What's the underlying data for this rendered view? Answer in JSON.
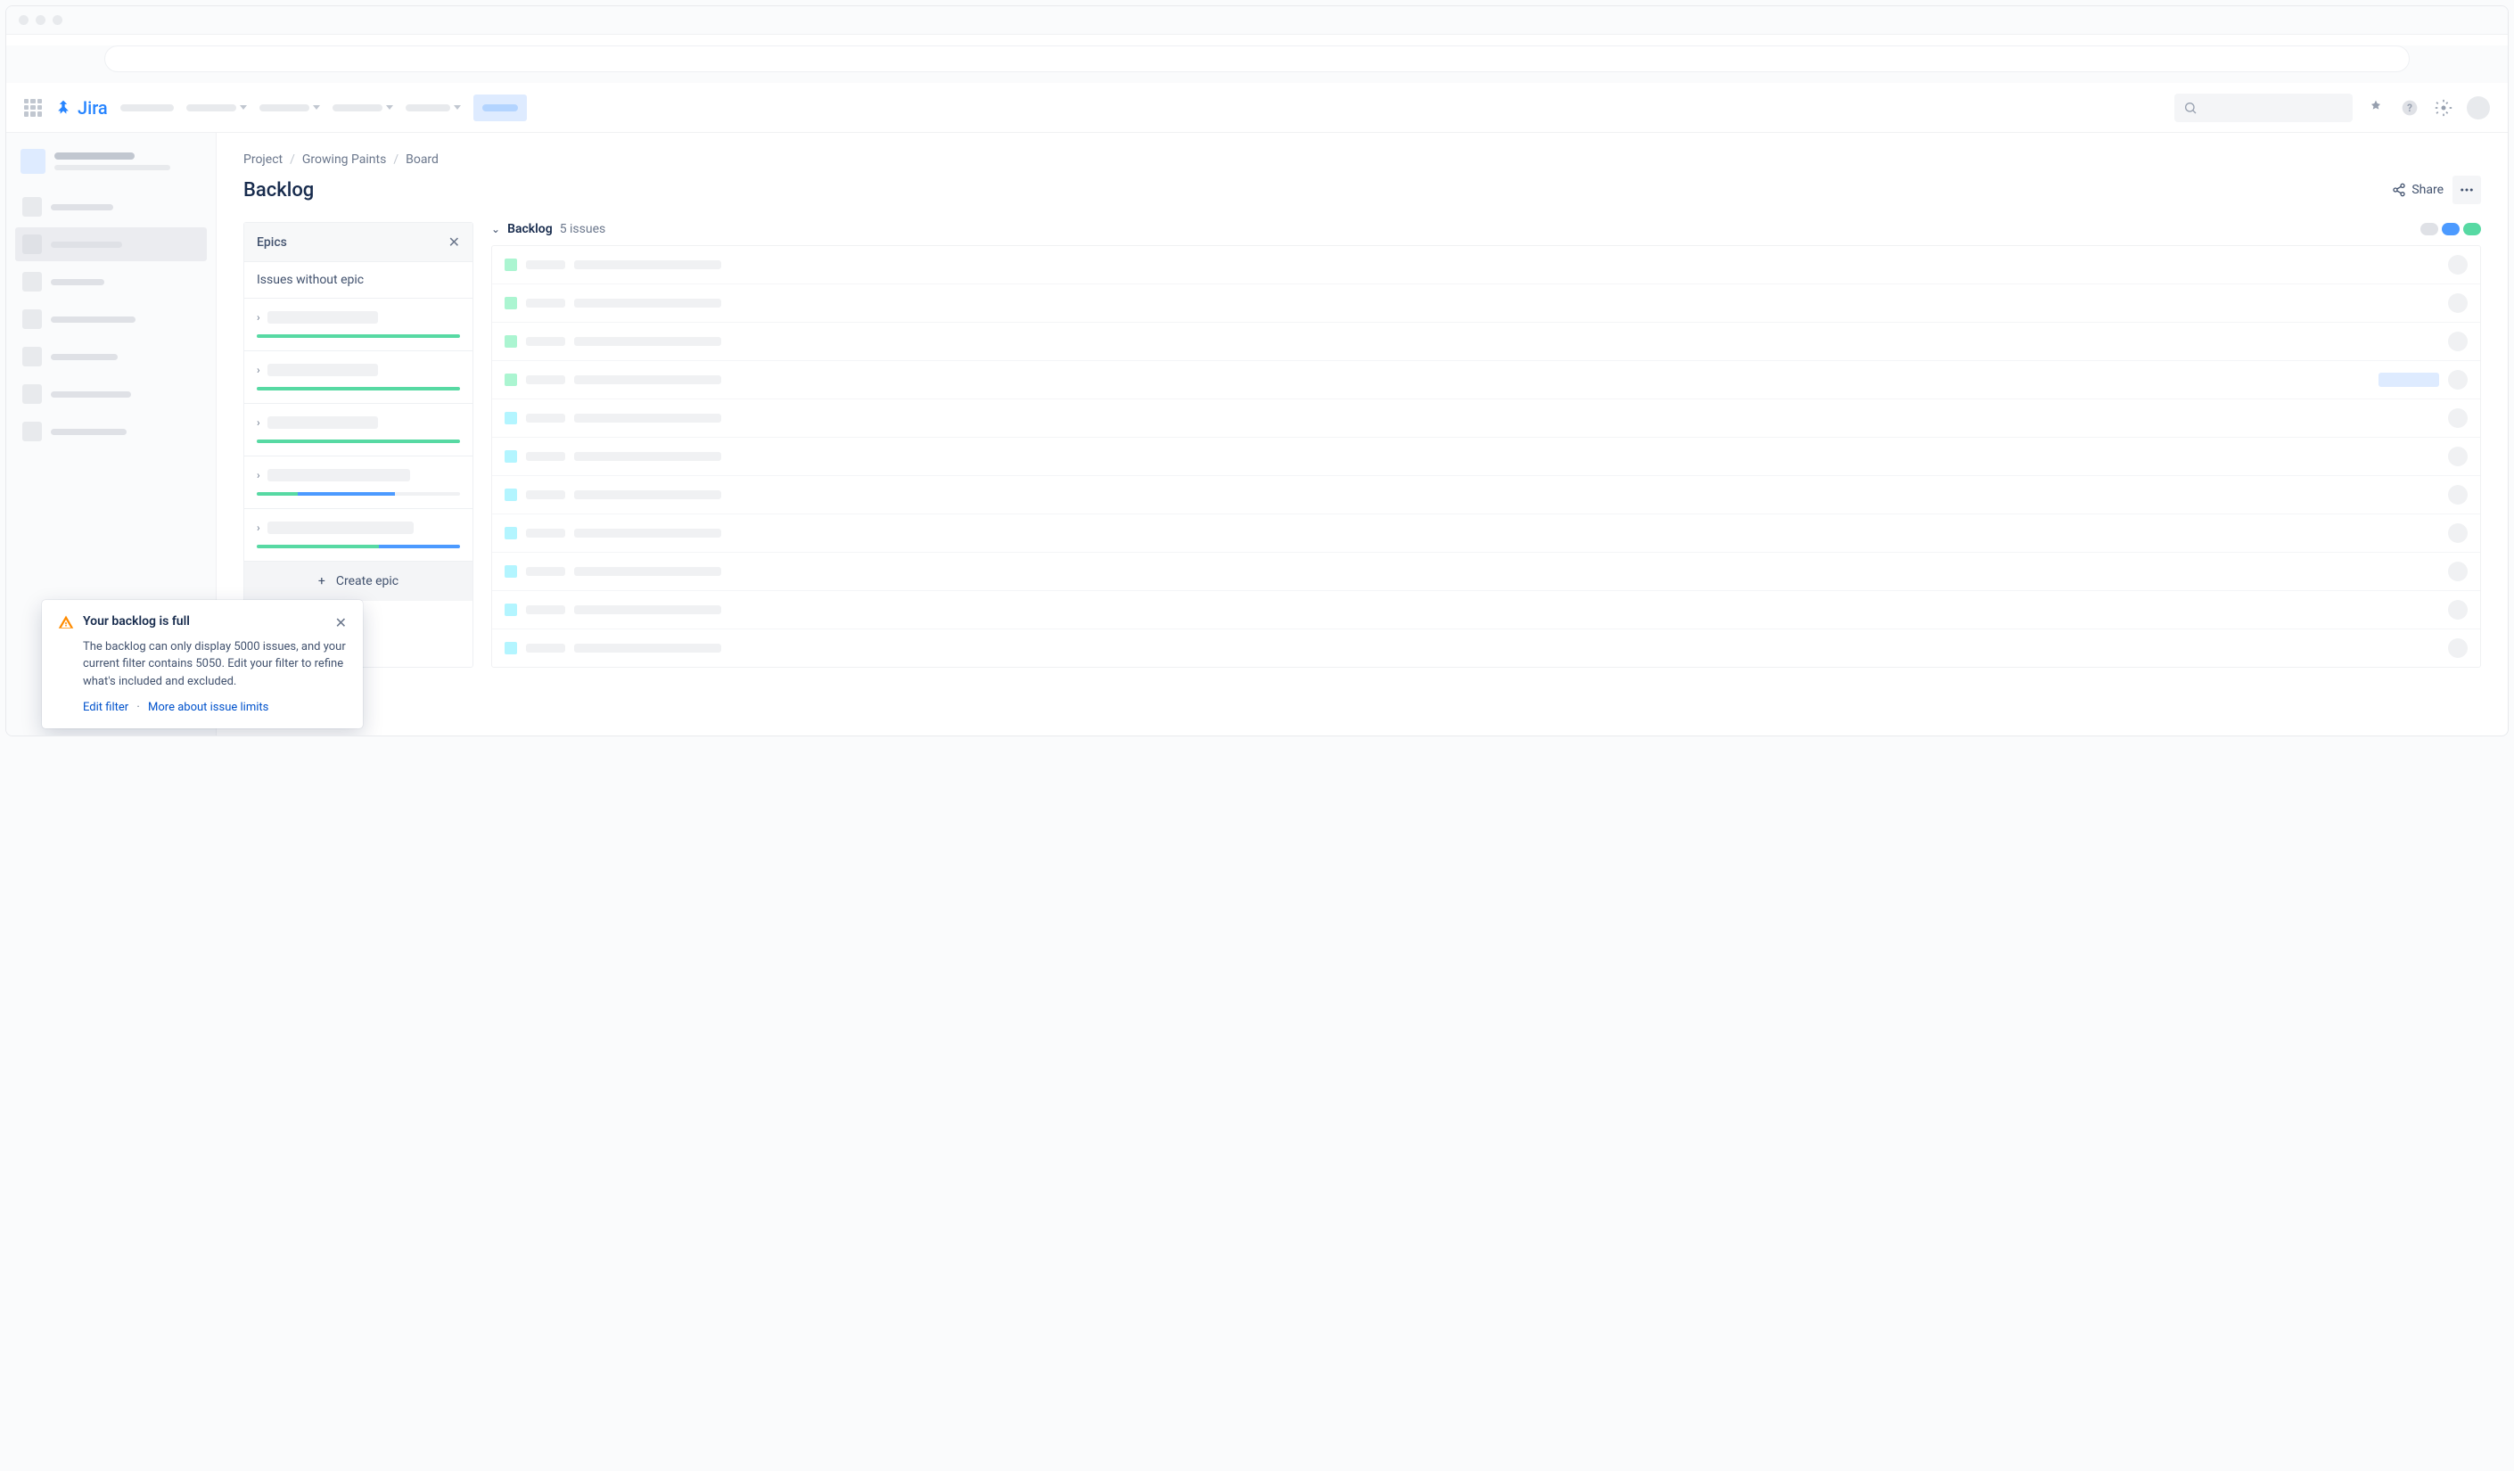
{
  "app": {
    "name": "Jira"
  },
  "breadcrumb": {
    "project": "Project",
    "growing_paints": "Growing Paints",
    "board": "Board"
  },
  "page": {
    "title": "Backlog"
  },
  "actions": {
    "share": "Share"
  },
  "epics": {
    "header": "Epics",
    "no_epic": "Issues without epic",
    "items": [
      {
        "progress": [
          {
            "w": 100,
            "c": "#57d9a3"
          }
        ]
      },
      {
        "progress": [
          {
            "w": 100,
            "c": "#57d9a3"
          }
        ]
      },
      {
        "progress": [
          {
            "w": 100,
            "c": "#57d9a3"
          }
        ]
      },
      {
        "progress": [
          {
            "w": 20,
            "c": "#57d9a3"
          },
          {
            "w": 48,
            "c": "#4c9aff"
          }
        ]
      },
      {
        "progress": [
          {
            "w": 60,
            "c": "#57d9a3"
          },
          {
            "w": 40,
            "c": "#4c9aff"
          }
        ]
      }
    ],
    "create": "Create epic"
  },
  "backlog": {
    "title": "Backlog",
    "count": "5 issues",
    "pills": [
      "#dfe1e6",
      "#4c9aff",
      "#57d9a3"
    ],
    "issues": [
      {
        "type_color": "#abf5d1",
        "has_badge": false
      },
      {
        "type_color": "#abf5d1",
        "has_badge": false
      },
      {
        "type_color": "#abf5d1",
        "has_badge": false
      },
      {
        "type_color": "#abf5d1",
        "has_badge": true
      },
      {
        "type_color": "#b3f5ff",
        "has_badge": false
      },
      {
        "type_color": "#b3f5ff",
        "has_badge": false
      },
      {
        "type_color": "#b3f5ff",
        "has_badge": false
      },
      {
        "type_color": "#b3f5ff",
        "has_badge": false
      },
      {
        "type_color": "#b3f5ff",
        "has_badge": false
      },
      {
        "type_color": "#b3f5ff",
        "has_badge": false
      },
      {
        "type_color": "#b3f5ff",
        "has_badge": false
      }
    ]
  },
  "toast": {
    "title": "Your backlog is full",
    "body": "The backlog can only display 5000 issues, and your current filter contains 5050. Edit your filter to refine what's included and excluded.",
    "edit": "Edit filter",
    "more": "More about issue limits"
  }
}
